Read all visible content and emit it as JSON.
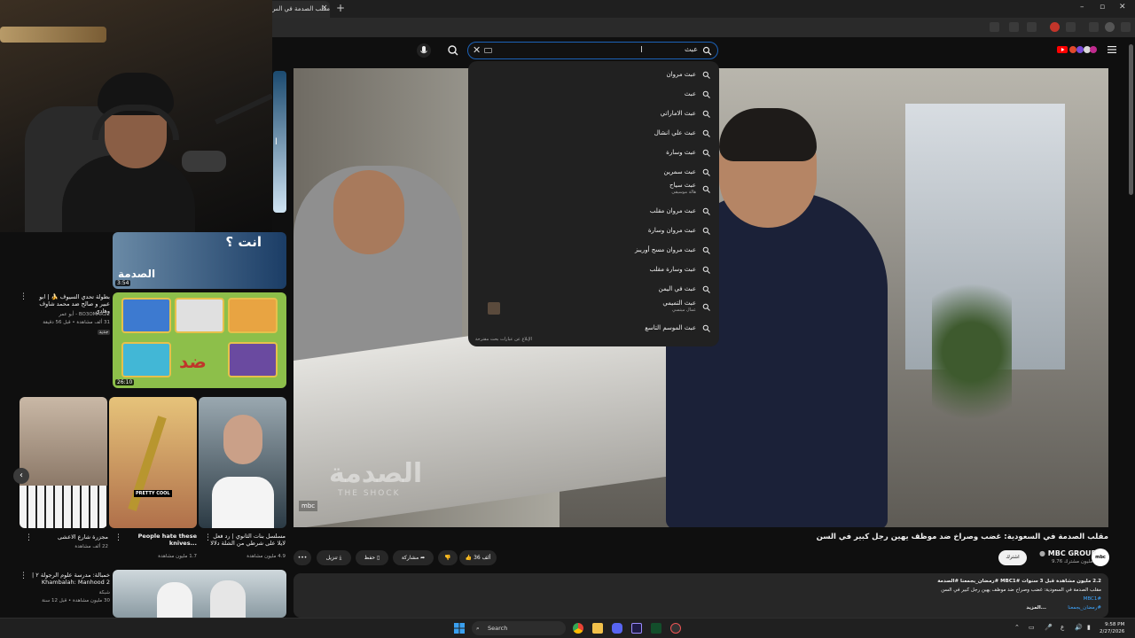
{
  "browser": {
    "tab_title": "مقلب الصدمة في الس",
    "tab_close": "×",
    "new_tab": "+",
    "window_controls": [
      "–",
      "▫",
      "✕"
    ]
  },
  "search": {
    "query": "عبث",
    "suggestions": [
      {
        "text": "عبث مروان"
      },
      {
        "text": "عبث"
      },
      {
        "text": "عبث الاماراتي"
      },
      {
        "text": "عبث علي انشال"
      },
      {
        "text": "عبث وسارة"
      },
      {
        "text": "عبث سمرين"
      },
      {
        "text": "عبث سياح",
        "sub": "هالة موسيقى"
      },
      {
        "text": "عبث مروان مقلب"
      },
      {
        "text": "عبث مروان وسارة"
      },
      {
        "text": "عبث مروان مسح أوريبز"
      },
      {
        "text": "عبث وسارة مقلب"
      },
      {
        "text": "عبث في اليمن"
      },
      {
        "text": "عبث التميمي",
        "sub": "عمال ميتسي"
      },
      {
        "text": "عبث الموسم التاسع"
      }
    ],
    "report_text": "الإبلاغ عن عبارات بحث مقترحة"
  },
  "video": {
    "watermark": "الصدمة",
    "watermark_sub": "THE SHOCK",
    "channel_bug": "mbc",
    "title": "مقلب الصدمة في السعودية: غضب وصراخ ضد موظف يهين رجل كبير في السن",
    "channel": "MBC GROUP",
    "subscribers": "9.76 مليون مشترك",
    "avatar_text": "mbc",
    "subscribe_label": "اشترك",
    "likes": "36 ألف",
    "share_label": "مشاركة",
    "save_label": "حفظ",
    "download_label": "تنزيل",
    "more_label": "•••"
  },
  "description": {
    "meta": "2.2 مليون مشاهدة قبل 3 سنوات #MBC1 #رمضان_يجمعنا #الصدمة",
    "line1": "مقلب الصدمة في السعودية: غضب وصراخ ضد موظف يهين رجل كبير في السن",
    "tag1": "#MBC1",
    "tag2": "#رمضان_يجمعنا",
    "more": "...المزيد"
  },
  "recommendations": [
    {
      "duration": "3:54",
      "title": "",
      "meta": ""
    },
    {
      "duration": "26:10",
      "title": "بطولة تحدي السيوف 🍌 | ابو عبير و صالح ضد محمد شاوف وهادي",
      "channel": "BO3OMAR22 - أبو عمر",
      "meta": "31 ألف مشاهدة • قبل 56 دقيقة",
      "badge": "جديد"
    },
    {
      "title": "مجزرة شارع الاعشى",
      "meta": "22 ألف مشاهدة"
    },
    {
      "title": "People hate these knives...",
      "meta": "1.7 مليون مشاهدة"
    },
    {
      "title": "مسلسل بنات الثانوي | رد فعل لايلا على شرطي من الشلة دلالا",
      "meta": "4.9 مليون مشاهدة"
    },
    {
      "title": "خمبالة: مدرسة علوم الرجولة ٢ | Khambalah: Manhood 2",
      "channel": "شبكة",
      "meta": "30 مليون مشاهدة • قبل 12 سنة"
    }
  ],
  "rec_text": {
    "thumb1_overlay": "انت ؟",
    "thumb2_overlay": "ضد",
    "knife_label": "PRETTY COOL",
    "side_strip_label": "ا"
  },
  "taskbar": {
    "search_placeholder": "Search",
    "time": "9:58 PM",
    "date": "2/27/2026",
    "tray_lang": "ع"
  },
  "colors": {
    "accent_blue": "#1c62b9",
    "link_blue": "#3ea6ff",
    "yt_red": "#ff0000"
  }
}
